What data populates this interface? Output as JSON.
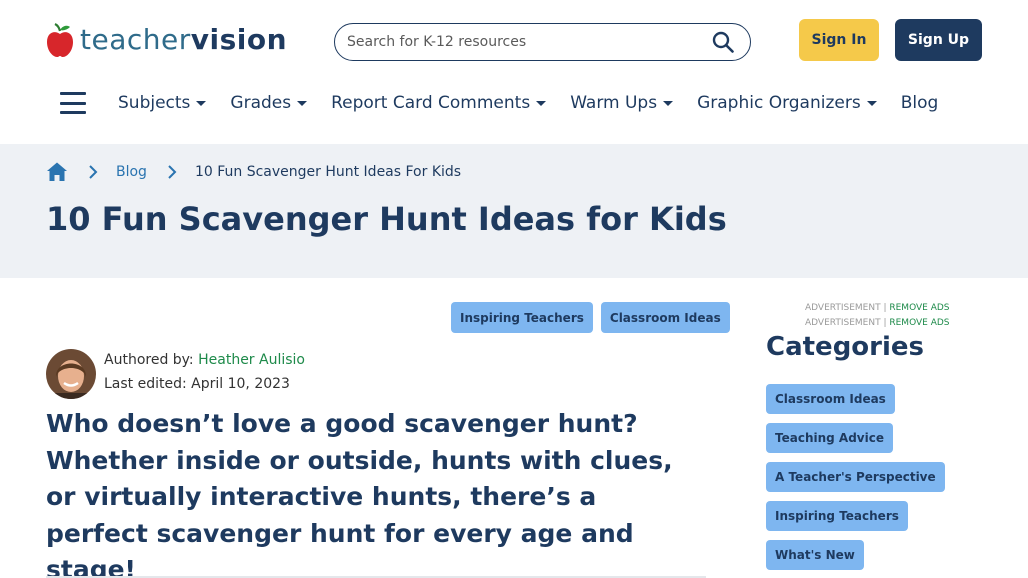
{
  "header": {
    "logo_part1": "teacher",
    "logo_part2": "vision",
    "search_placeholder": "Search for K-12 resources",
    "signin_label": "Sign In",
    "signup_label": "Sign Up"
  },
  "nav": {
    "items": [
      {
        "label": "Subjects",
        "dropdown": true
      },
      {
        "label": "Grades",
        "dropdown": true
      },
      {
        "label": "Report Card Comments",
        "dropdown": true
      },
      {
        "label": "Warm Ups",
        "dropdown": true
      },
      {
        "label": "Graphic Organizers",
        "dropdown": true
      },
      {
        "label": "Blog",
        "dropdown": false
      }
    ]
  },
  "breadcrumb": {
    "blog": "Blog",
    "current": "10 Fun Scavenger Hunt Ideas For Kids"
  },
  "page": {
    "title": "10 Fun Scavenger Hunt Ideas for Kids"
  },
  "article": {
    "tags": [
      "Inspiring Teachers",
      "Classroom Ideas"
    ],
    "author_prefix": "Authored by: ",
    "author_name": "Heather Aulisio",
    "edited": "Last edited: April 10, 2023",
    "lede": "Who doesn’t love a good scavenger hunt? Whether inside or outside, hunts with clues, or virtually interactive hunts, there’s a perfect scavenger hunt for every age and stage!"
  },
  "sidebar": {
    "ad_label": "ADVERTISEMENT | ",
    "remove_ads": "REMOVE ADS",
    "categories_title": "Categories",
    "categories": [
      "Classroom Ideas",
      "Teaching Advice",
      "A Teacher's Perspective",
      "Inspiring Teachers",
      "What's New"
    ]
  },
  "colors": {
    "navy": "#1e3a5f",
    "yellow": "#f5c94a",
    "tag_blue": "#7eb6f0",
    "band_gray": "#eef1f5",
    "link_green": "#1e8a4a"
  }
}
